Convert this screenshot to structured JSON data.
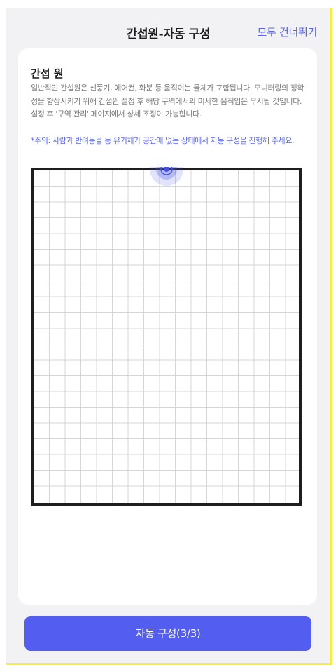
{
  "header": {
    "title": "간섭원-자동 구성",
    "skip_all_label": "모두 건너뛰기"
  },
  "section": {
    "title": "간섭 원",
    "description": "일반적인 간섭원은 선풍기, 에어컨, 화분 등 움직이는 물체가 포함됩니다. 모니터링의 정확성을 향상시키기 위해 간섭원 설정 후 해당 구역에서의 미세한 움직임은 무시될 것입니다. 설정 후 '구역 관리' 페이지에서 상세 조정이 가능합니다.",
    "notice": "*주의: 사람과 반려동물 등 유기체가 공간에 없는 상태에서 자동 구성을 진행해 주세요."
  },
  "grid": {
    "border_color": "#1e1e1e",
    "line_color": "#d6d6d6",
    "sensor_color": "#4452e0"
  },
  "action": {
    "button_label": "자동 구성(3/3)"
  },
  "colors": {
    "accent": "#535ef0",
    "link": "#5a66e6",
    "background": "#f2f2f5",
    "frame_highlight": "#f8ee3a"
  }
}
